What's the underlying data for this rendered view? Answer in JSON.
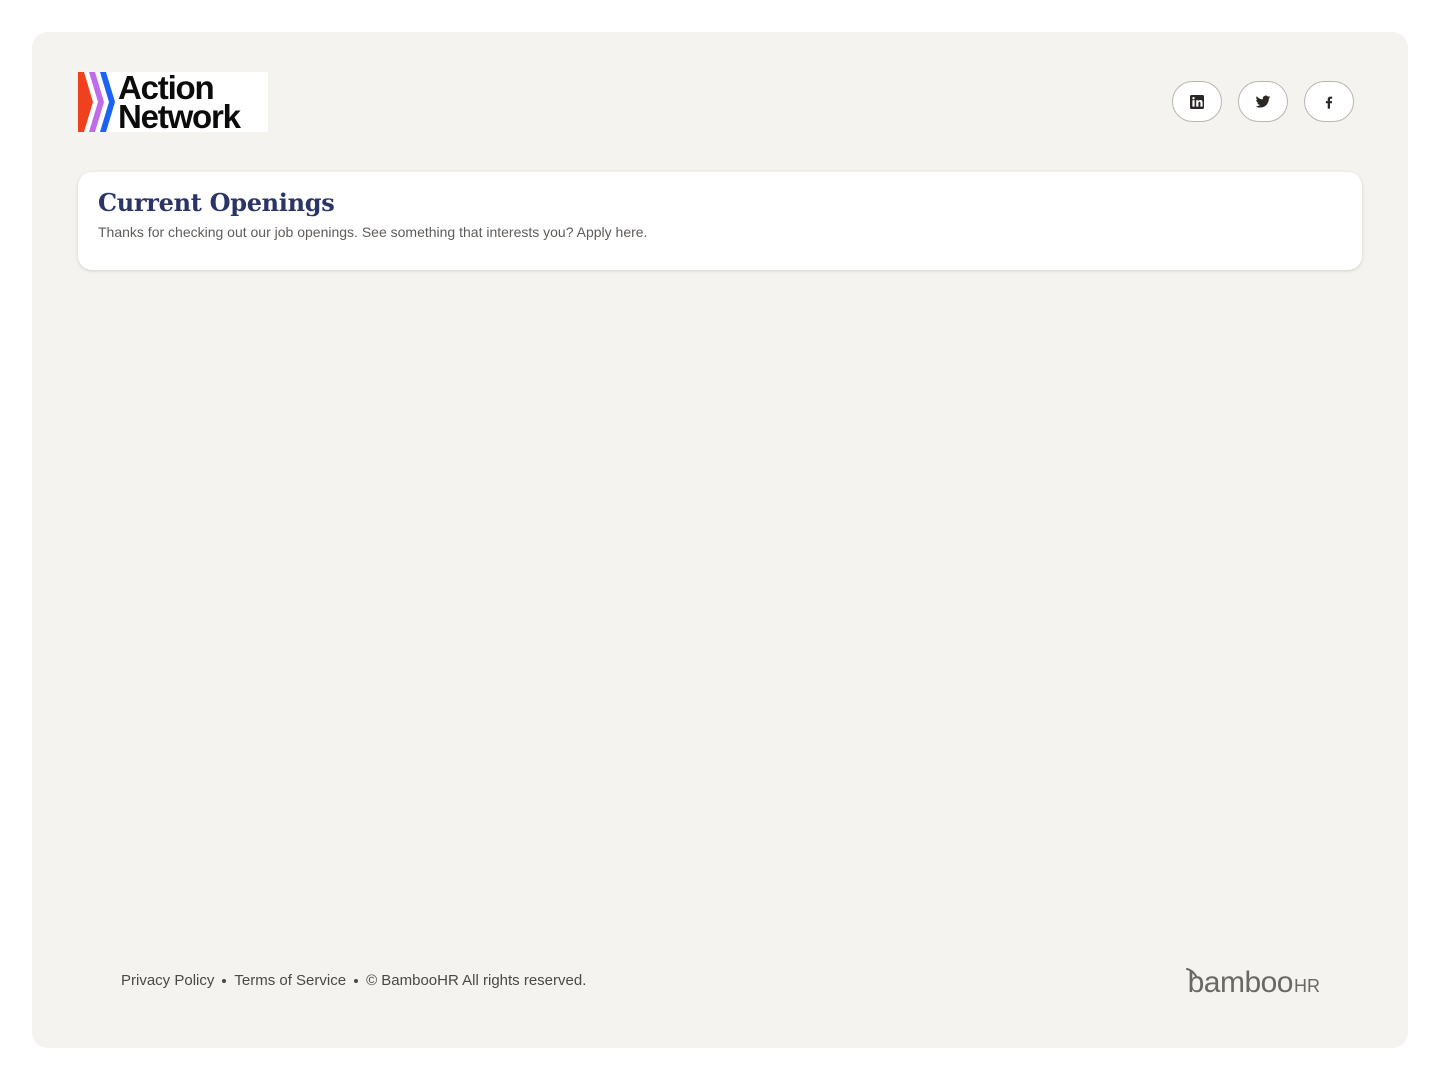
{
  "brand": {
    "name": "Action Network",
    "line1": "Action",
    "line2": "Network",
    "chevron_colors": [
      "#f0411e",
      "#c06be8",
      "#1b63f2"
    ]
  },
  "social": {
    "linkedin": "linkedin-icon",
    "twitter": "twitter-icon",
    "facebook": "facebook-icon"
  },
  "card": {
    "title": "Current Openings",
    "subtitle": "Thanks for checking out our job openings. See something that interests you? Apply here."
  },
  "footer": {
    "privacy": "Privacy Policy",
    "terms": "Terms of Service",
    "copyright": "© BambooHR All rights reserved.",
    "powered_by_main": "bamboo",
    "powered_by_hr": "HR"
  },
  "colors": {
    "background": "#f5f3f0",
    "title": "#2b3466",
    "text": "#5f5c59"
  }
}
